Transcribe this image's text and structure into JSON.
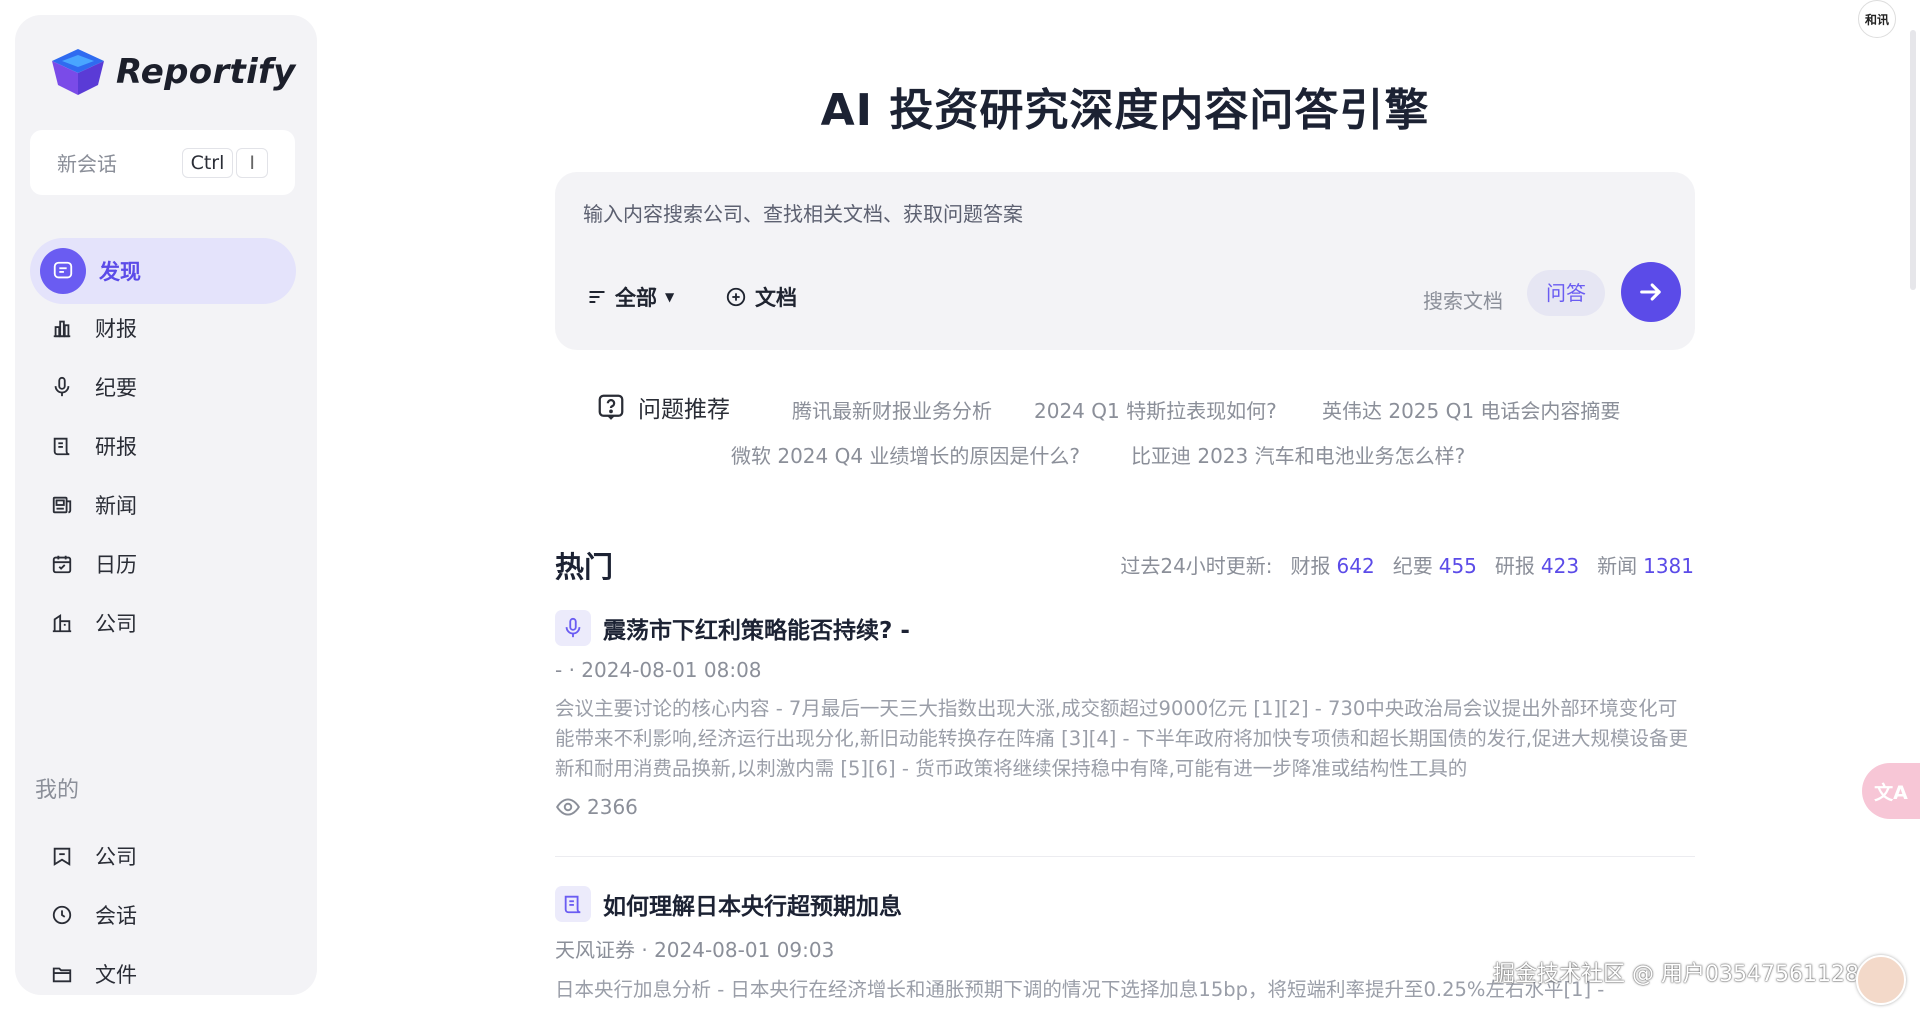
{
  "app": {
    "name": "Reportify"
  },
  "sidebar": {
    "new_chat_label": "新会话",
    "shortcut_key": "Ctrl",
    "shortcut_key2": "I",
    "nav": [
      {
        "label": "发现",
        "icon": "chat-bubble-icon",
        "active": true
      },
      {
        "label": "财报",
        "icon": "bar-chart-icon"
      },
      {
        "label": "纪要",
        "icon": "microphone-icon"
      },
      {
        "label": "研报",
        "icon": "scroll-icon"
      },
      {
        "label": "新闻",
        "icon": "newspaper-icon"
      },
      {
        "label": "日历",
        "icon": "calendar-icon"
      },
      {
        "label": "公司",
        "icon": "building-icon"
      }
    ],
    "mine_label": "我的",
    "mine": [
      {
        "label": "公司",
        "icon": "bookmark-icon"
      },
      {
        "label": "会话",
        "icon": "clock-icon"
      },
      {
        "label": "文件",
        "icon": "folder-icon"
      }
    ]
  },
  "main": {
    "title": "AI 投资研究深度内容问答引擎",
    "search": {
      "placeholder": "输入内容搜索公司、查找相关文档、获取问题答案",
      "filter_label": "全部",
      "doc_label": "文档",
      "mode_search": "搜索文档",
      "mode_qa": "问答"
    },
    "suggestions": {
      "title": "问题推荐",
      "items": [
        "腾讯最新财报业务分析",
        "2024 Q1 特斯拉表现如何?",
        "英伟达 2025 Q1 电话会内容摘要",
        "微软 2024 Q4 业绩增长的原因是什么?",
        "比亚迪 2023 汽车和电池业务怎么样?"
      ]
    },
    "hot": {
      "title": "热门",
      "stats_prefix": "过去24小时更新:",
      "stats": [
        {
          "label": "财报",
          "value": "642"
        },
        {
          "label": "纪要",
          "value": "455"
        },
        {
          "label": "研报",
          "value": "423"
        },
        {
          "label": "新闻",
          "value": "1381"
        }
      ],
      "articles": [
        {
          "icon": "microphone-icon",
          "title": "震荡市下红利策略能否持续? -",
          "meta": "- · 2024-08-01 08:08",
          "body": "会议主要讨论的核心内容 - 7月最后一天三大指数出现大涨,成交额超过9000亿元 [1][2] - 730中央政治局会议提出外部环境变化可能带来不利影响,经济运行出现分化,新旧动能转换存在阵痛 [3][4] - 下半年政府将加快专项债和超长期国债的发行,促进大规模设备更新和耐用消费品换新,以刺激内需 [5][6] - 货币政策将继续保持稳中有降,可能有进一步降准或结构性工具的",
          "views": "2366"
        },
        {
          "icon": "scroll-icon",
          "title": "如何理解日本央行超预期加息",
          "meta": "天风证券 · 2024-08-01 09:03",
          "body": "日本央行加息分析 - 日本央行在经济增长和通胀预期下调的情况下选择加息15bp，将短端利率提升至0.25%左右水平[1] -"
        }
      ]
    }
  },
  "overlay": {
    "top_badge": "和讯",
    "watermark": "掘金技术社区 @ 用户035475611288",
    "translate_glyph": "文A"
  }
}
